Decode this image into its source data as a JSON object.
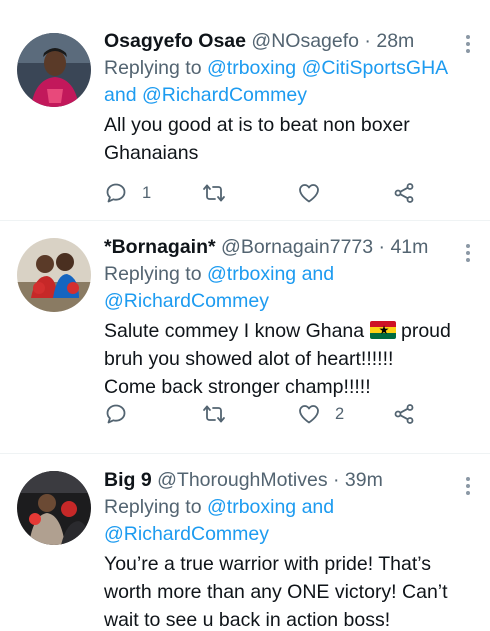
{
  "tweets": [
    {
      "name": "Osagyefo Osae",
      "handle": "@NOsagefo",
      "time": "28m",
      "replying_label": "Replying to",
      "mentions": [
        "@trboxing",
        "@CitiSportsGHA"
      ],
      "mention_join": "and",
      "mention_last": "@RichardCommey",
      "text_lines": [
        "All you good at is to beat  non boxer",
        "Ghanaians"
      ],
      "reply_count": "1",
      "like_count": ""
    },
    {
      "name": "*Bornagain*",
      "handle": "@Bornagain7773",
      "time": "41m",
      "replying_label": "Replying to",
      "mentions": [
        "@trboxing"
      ],
      "mention_join": "and",
      "mention_last": "@RichardCommey",
      "text_line1_before": "Salute commey I know Ghana",
      "text_line1_after": "proud",
      "text_lines": [
        "bruh  you showed alot of heart!!!!!!",
        "Come back stronger champ!!!!!"
      ],
      "reply_count": "",
      "like_count": "2"
    },
    {
      "name": "Big 9",
      "handle": "@ThoroughMotives",
      "time": "39m",
      "replying_label": "Replying to",
      "mentions": [
        "@trboxing"
      ],
      "mention_join": "and",
      "mention_last": "@RichardCommey",
      "text_lines": [
        "You’re a true warrior with pride! That’s",
        "worth more than any ONE victory! Can’t",
        "wait to see u back in action boss!"
      ]
    }
  ],
  "separator": "·",
  "icons": {
    "reply": "reply-icon",
    "retweet": "retweet-icon",
    "like": "heart-icon",
    "share": "share-icon",
    "more": "more-icon",
    "flag": "ghana-flag-icon"
  },
  "colors": {
    "link": "#1d9bf0",
    "secondary": "#536471",
    "text": "#0f1419",
    "divider": "#eff3f4"
  }
}
